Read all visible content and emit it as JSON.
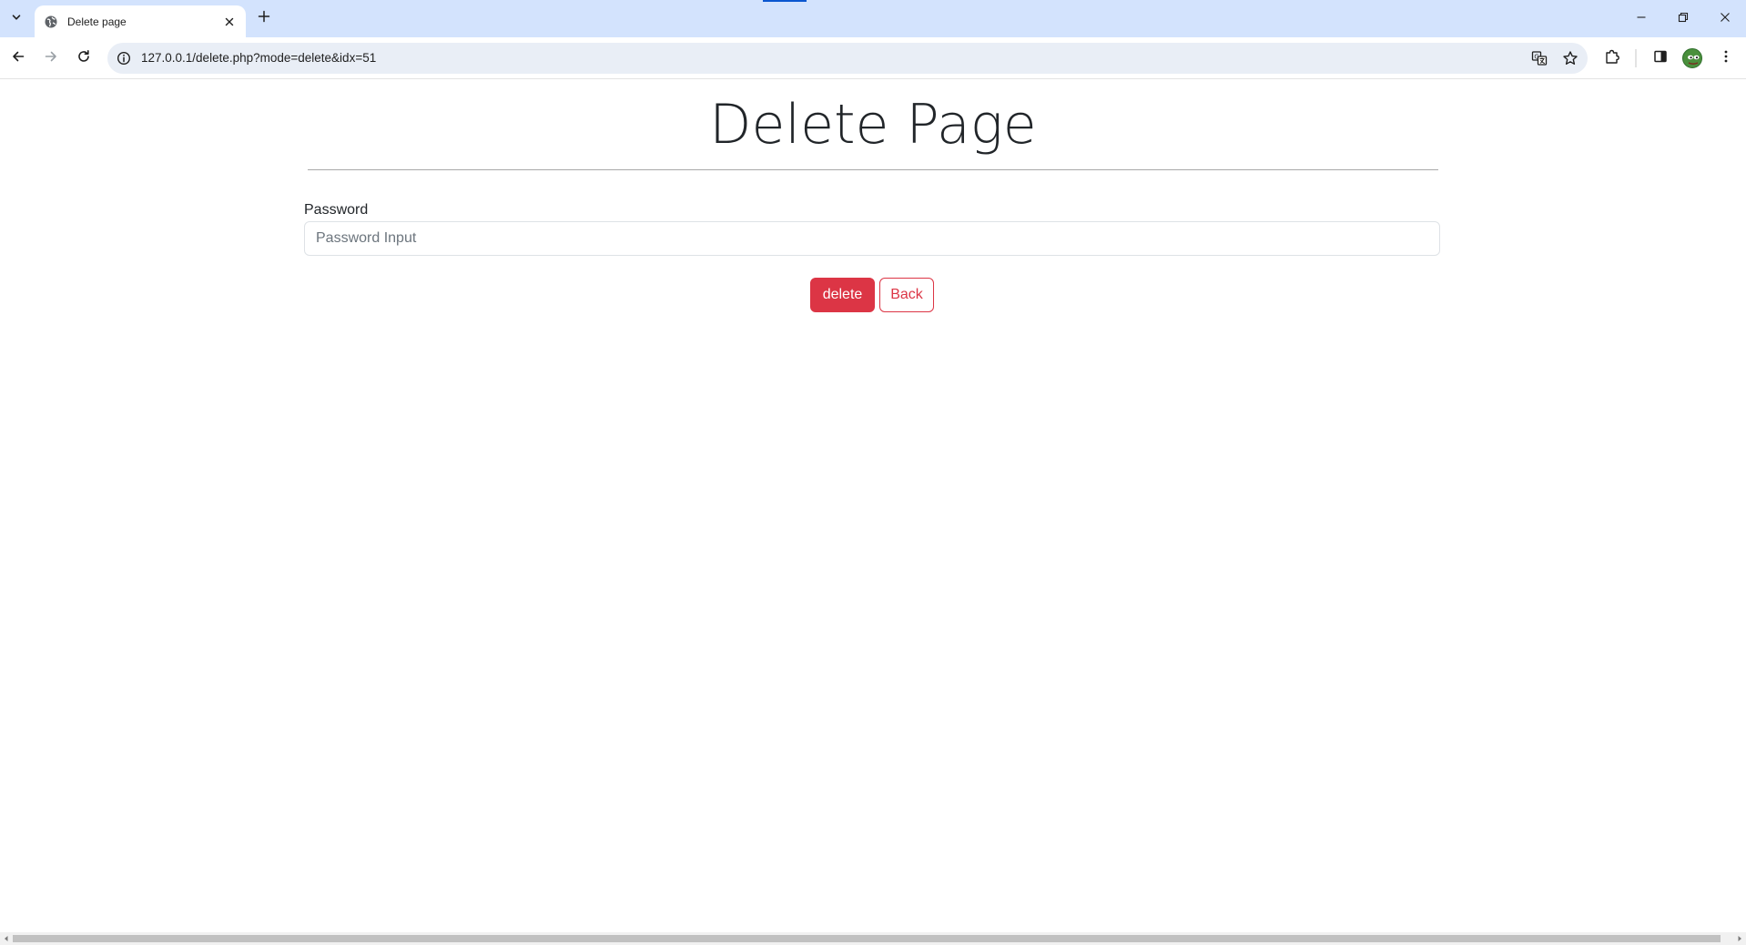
{
  "browser": {
    "tab_title": "Delete page",
    "url": "127.0.0.1/delete.php?mode=delete&idx=51"
  },
  "page": {
    "title": "Delete Page",
    "password_label": "Password",
    "password_placeholder": "Password Input",
    "password_value": "",
    "delete_button_label": "delete",
    "back_button_label": "Back"
  },
  "colors": {
    "danger": "#dc3545",
    "chrome_tabstrip": "#d3e3fd",
    "omnibox_bg": "#e9eef6"
  },
  "icons": {
    "tab_search": "chevron-down-icon",
    "favicon": "globe-icon",
    "tab_close": "close-icon",
    "new_tab": "plus-icon",
    "back": "arrow-left-icon",
    "forward": "arrow-right-icon",
    "reload": "reload-icon",
    "site_info": "info-icon",
    "translate": "translate-icon",
    "bookmark": "star-icon",
    "extensions": "puzzle-icon",
    "side_panel": "side-panel-icon",
    "menu": "kebab-menu-icon"
  }
}
